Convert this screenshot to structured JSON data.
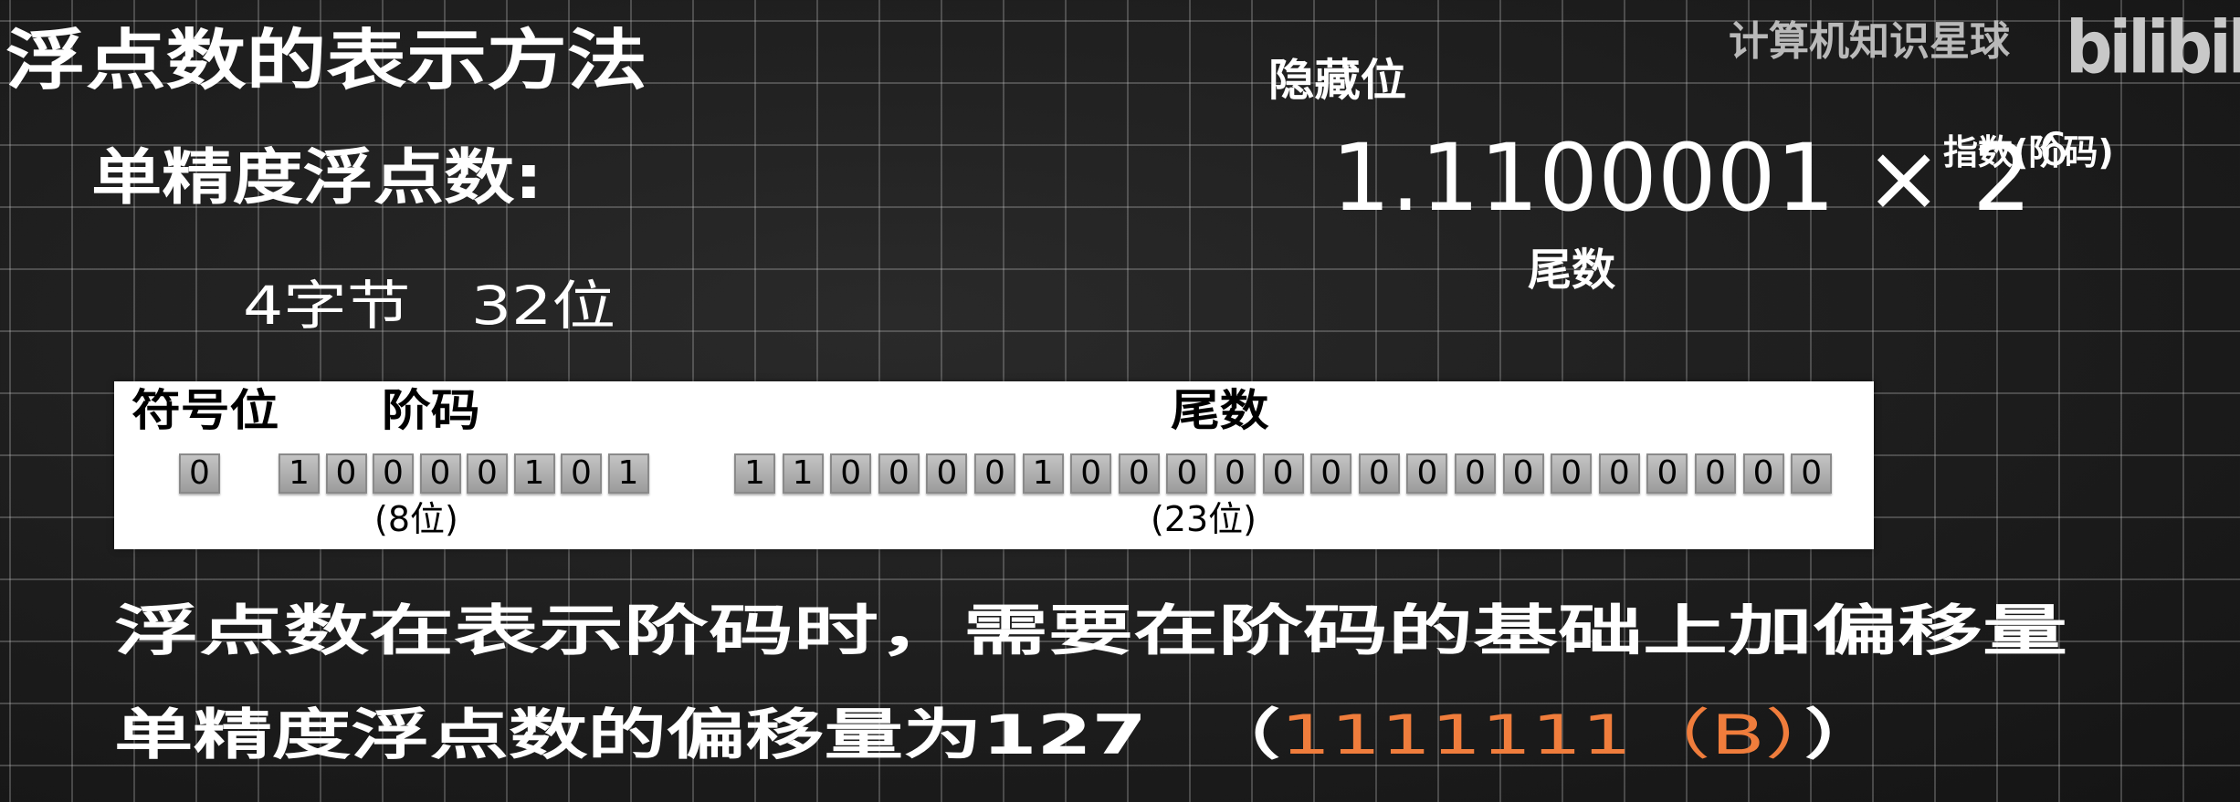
{
  "title": "浮点数的表示方法",
  "subtitle": "单精度浮点数:",
  "size": {
    "bytes": "4字节",
    "bits": "32位"
  },
  "formula": {
    "hidden_bit_label": "隐藏位",
    "mantissa": "1.1100001",
    "times": "×",
    "base": "2",
    "exponent": "6",
    "exponent_label": "指数(阶码)",
    "mantissa_label": "尾数"
  },
  "watermark": {
    "channel": "计算机知识星球",
    "logo": "bilibili"
  },
  "layout_table": {
    "sign_label": "符号位",
    "exponent_label": "阶码",
    "mantissa_label": "尾数",
    "exponent_width": "(8位)",
    "mantissa_width": "(23位)",
    "sign_bits": [
      "0"
    ],
    "exponent_bits": [
      "1",
      "0",
      "0",
      "0",
      "0",
      "1",
      "0",
      "1"
    ],
    "mantissa_bits": [
      "1",
      "1",
      "0",
      "0",
      "0",
      "0",
      "1",
      "0",
      "0",
      "0",
      "0",
      "0",
      "0",
      "0",
      "0",
      "0",
      "0",
      "0",
      "0",
      "0",
      "0",
      "0",
      "0"
    ]
  },
  "notes": {
    "line1": "浮点数在表示阶码时，需要在阶码的基础上加偏移量",
    "line2_prefix": "单精度浮点数的偏移量为127",
    "line2_open": "  （",
    "line2_highlight": "1111111（B）",
    "line2_close": "）",
    "highlight_color": "#f07d3c"
  }
}
